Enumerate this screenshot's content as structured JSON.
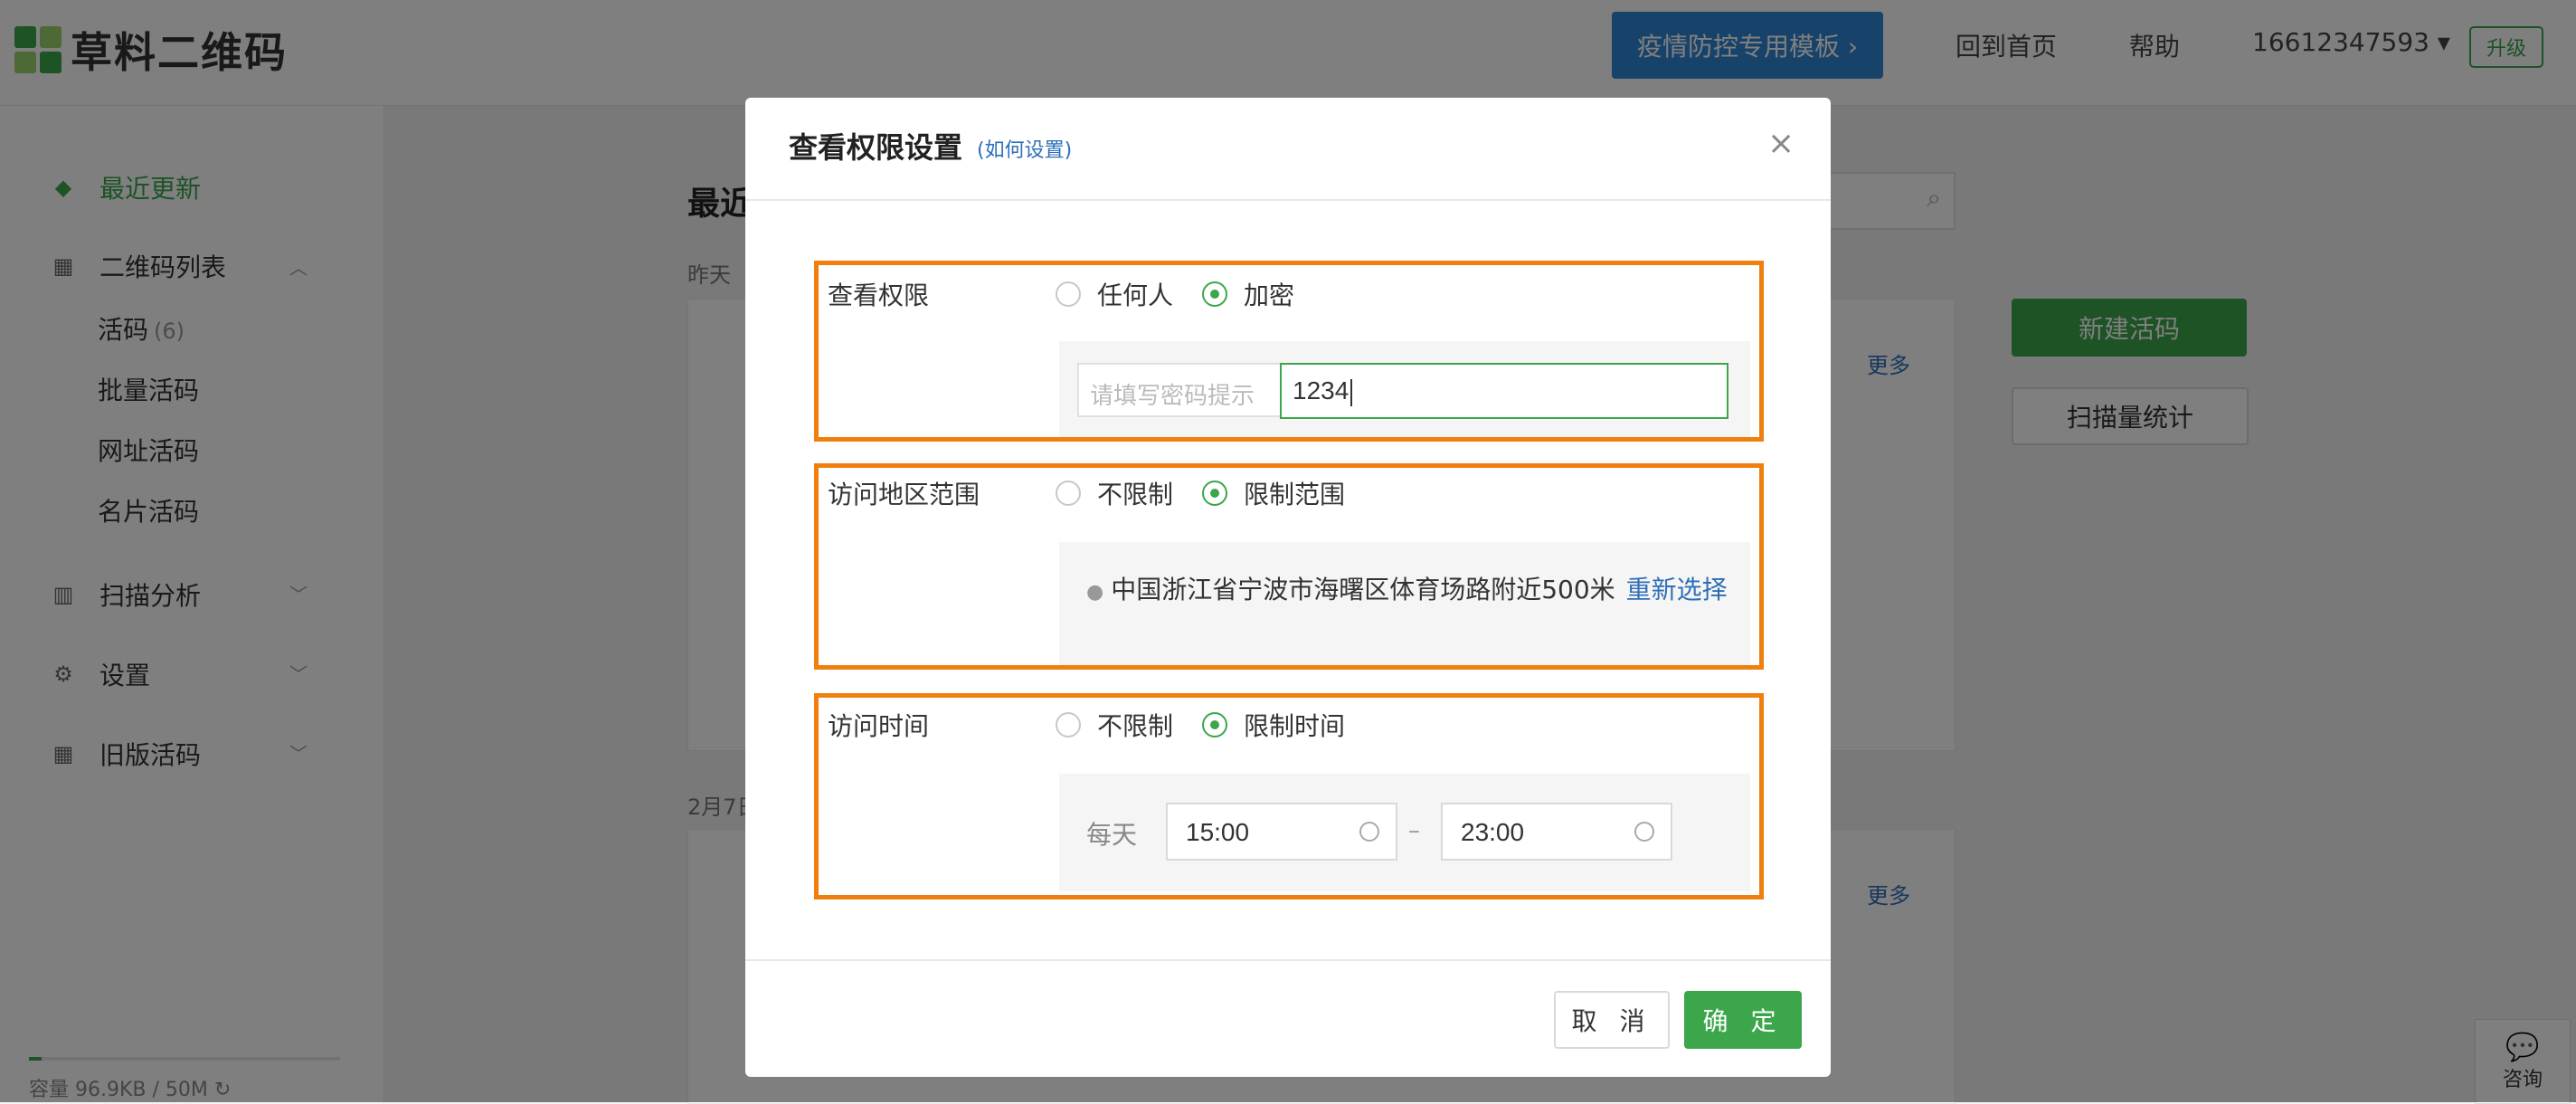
{
  "app": {
    "logo_text": "草料二维码"
  },
  "header": {
    "promo_button": "疫情防控专用模板 ›",
    "home_link": "回到首页",
    "help_link": "帮助",
    "account": "16612347593 ▾",
    "upgrade": "升级"
  },
  "sidebar": {
    "recent": "最近更新",
    "qr_list": "二维码列表",
    "sub_items": [
      {
        "label": "活码",
        "count": "(6)"
      },
      {
        "label": "批量活码"
      },
      {
        "label": "网址活码"
      },
      {
        "label": "名片活码"
      }
    ],
    "scan_analysis": "扫描分析",
    "settings": "设置",
    "legacy": "旧版活码",
    "storage": "容量 96.9KB / 50M"
  },
  "main": {
    "title": "最近",
    "date_yesterday": "昨天",
    "date_feb7": "2月7日",
    "more_1": "更多",
    "more_2": "更多",
    "new_button": "新建活码",
    "stats_button": "扫描量统计",
    "consult": "咨询"
  },
  "modal": {
    "title": "查看权限设置",
    "help_link": "(如何设置)",
    "close": "×",
    "permission": {
      "label": "查看权限",
      "option_anyone": "任何人",
      "option_encrypted": "加密",
      "selected": "加密",
      "hint_placeholder": "请填写密码提示",
      "password_value": "1234"
    },
    "region": {
      "label": "访问地区范围",
      "option_unlimited": "不限制",
      "option_limited": "限制范围",
      "selected": "限制范围",
      "location": "中国浙江省宁波市海曙区体育场路附近500米",
      "reselect": "重新选择"
    },
    "time": {
      "label": "访问时间",
      "option_unlimited": "不限制",
      "option_limited": "限制时间",
      "selected": "限制时间",
      "daily_label": "每天",
      "start": "15:00",
      "separator": "–",
      "end": "23:00"
    },
    "cancel": "取 消",
    "confirm": "确 定"
  },
  "colors": {
    "accent": "#3ba64a",
    "link": "#2e6fb8",
    "highlight": "#f07f0e",
    "promo": "#2e86d6"
  }
}
